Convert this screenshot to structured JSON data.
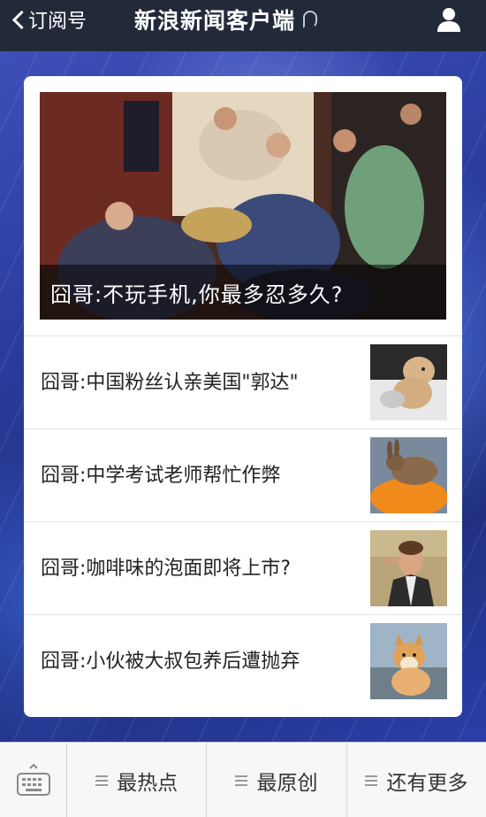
{
  "header": {
    "back_label": "订阅号",
    "title": "新浪新闻客户端"
  },
  "hero": {
    "caption": "囧哥:不玩手机,你最多忍多久?"
  },
  "articles": [
    {
      "title": "囧哥:中国粉丝认亲美国\"郭达\"",
      "thumb_icon": "dog-photo"
    },
    {
      "title": "囧哥:中学考试老师帮忙作弊",
      "thumb_icon": "rabbit-photo"
    },
    {
      "title": "囧哥:咖啡味的泡面即将上市?",
      "thumb_icon": "man-saluting-photo"
    },
    {
      "title": "囧哥:小伙被大叔包养后遭抛弃",
      "thumb_icon": "shiba-photo"
    }
  ],
  "bottom_menu": {
    "tabs": [
      {
        "label": "最热点"
      },
      {
        "label": "最原创"
      },
      {
        "label": "还有更多"
      }
    ]
  },
  "colors": {
    "topbar": "#222a3a",
    "card": "#ffffff",
    "bottombar": "#f7f7f7"
  }
}
